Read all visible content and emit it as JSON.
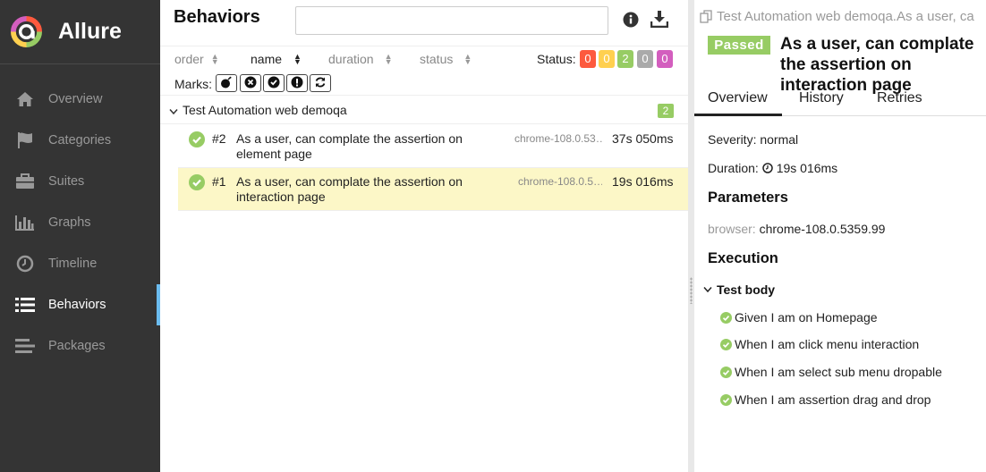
{
  "sidebar": {
    "brand": "Allure",
    "items": [
      {
        "label": "Overview",
        "icon": "home-icon"
      },
      {
        "label": "Categories",
        "icon": "flag-icon"
      },
      {
        "label": "Suites",
        "icon": "briefcase-icon"
      },
      {
        "label": "Graphs",
        "icon": "bar-chart-icon"
      },
      {
        "label": "Timeline",
        "icon": "clock-icon"
      },
      {
        "label": "Behaviors",
        "icon": "list-icon",
        "active": true
      },
      {
        "label": "Packages",
        "icon": "align-left-icon"
      }
    ]
  },
  "behaviors": {
    "title": "Behaviors",
    "search_value": "",
    "sort": {
      "columns": [
        {
          "label": "order"
        },
        {
          "label": "name",
          "active": true
        },
        {
          "label": "duration"
        },
        {
          "label": "status"
        }
      ]
    },
    "status_label": "Status:",
    "status_counts": [
      {
        "value": "0",
        "color": "#fd5a3e"
      },
      {
        "value": "0",
        "color": "#ffd050"
      },
      {
        "value": "2",
        "color": "#97cc64"
      },
      {
        "value": "0",
        "color": "#aaaaaa"
      },
      {
        "value": "0",
        "color": "#d35ebe"
      }
    ],
    "marks_label": "Marks:",
    "marks": [
      "bomb-icon",
      "times-circle-icon",
      "check-circle-icon",
      "exclamation-circle-icon",
      "refresh-icon"
    ],
    "group": {
      "name": "Test Automation web demoqa",
      "count": "2"
    },
    "tests": [
      {
        "num": "#2",
        "name": "As a user, can complate the assertion on element page",
        "param": "chrome-108.0.53…",
        "duration": "37s 050ms",
        "selected": false
      },
      {
        "num": "#1",
        "name": "As a user, can complate the assertion on interaction page",
        "param": "chrome-108.0.5…",
        "duration": "19s 016ms",
        "selected": true
      }
    ]
  },
  "detail": {
    "breadcrumb": "Test Automation web demoqa.As a user, ca",
    "status": "Passed",
    "title": "As a user, can complate the assertion on interaction page",
    "tabs": [
      "Overview",
      "History",
      "Retries"
    ],
    "severity_label": "Severity:",
    "severity_value": "normal",
    "duration_label": "Duration:",
    "duration_value": "19s 016ms",
    "parameters_heading": "Parameters",
    "param_key": "browser",
    "param_value": "chrome-108.0.5359.99",
    "execution_heading": "Execution",
    "test_body_label": "Test body",
    "steps": [
      "Given I am on Homepage",
      "When I am click menu interaction",
      "When I am select sub menu dropable",
      "When I am assertion drag and drop"
    ]
  },
  "colors": {
    "sidebar_bg": "#343434",
    "passed": "#97cc64",
    "selected_row": "#fcf7c7",
    "active_accent": "#6bbcef"
  }
}
